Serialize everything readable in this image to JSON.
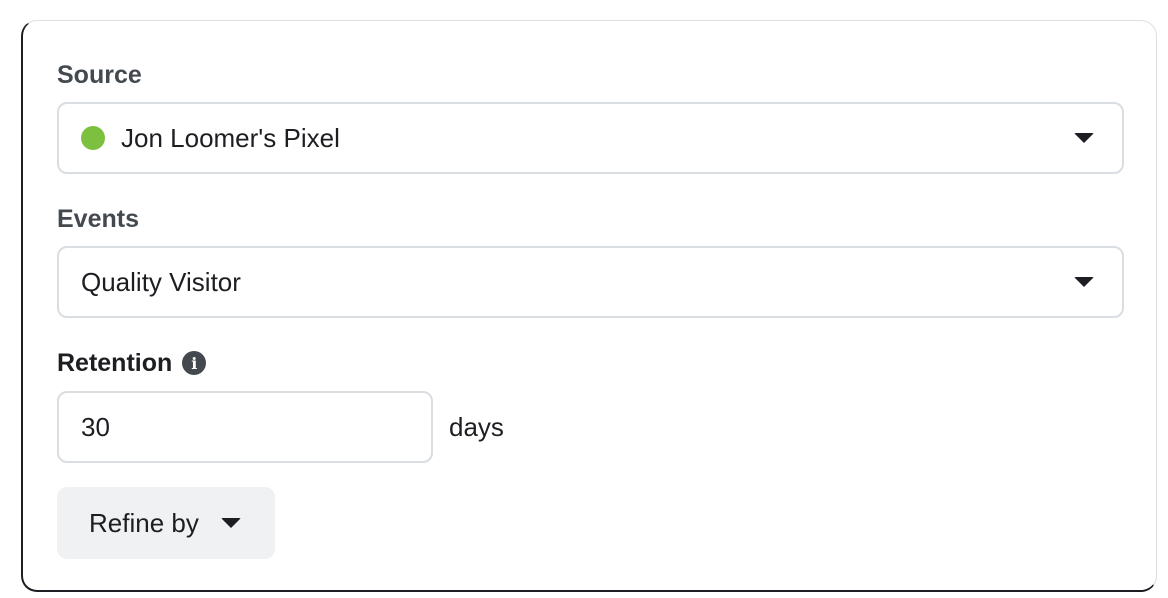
{
  "source": {
    "label": "Source",
    "selected": "Jon Loomer's Pixel",
    "status_color": "#7dc03f"
  },
  "events": {
    "label": "Events",
    "selected": "Quality Visitor"
  },
  "retention": {
    "label": "Retention",
    "value": "30",
    "unit": "days"
  },
  "refine": {
    "label": "Refine by"
  },
  "icons": {
    "info": "i"
  }
}
